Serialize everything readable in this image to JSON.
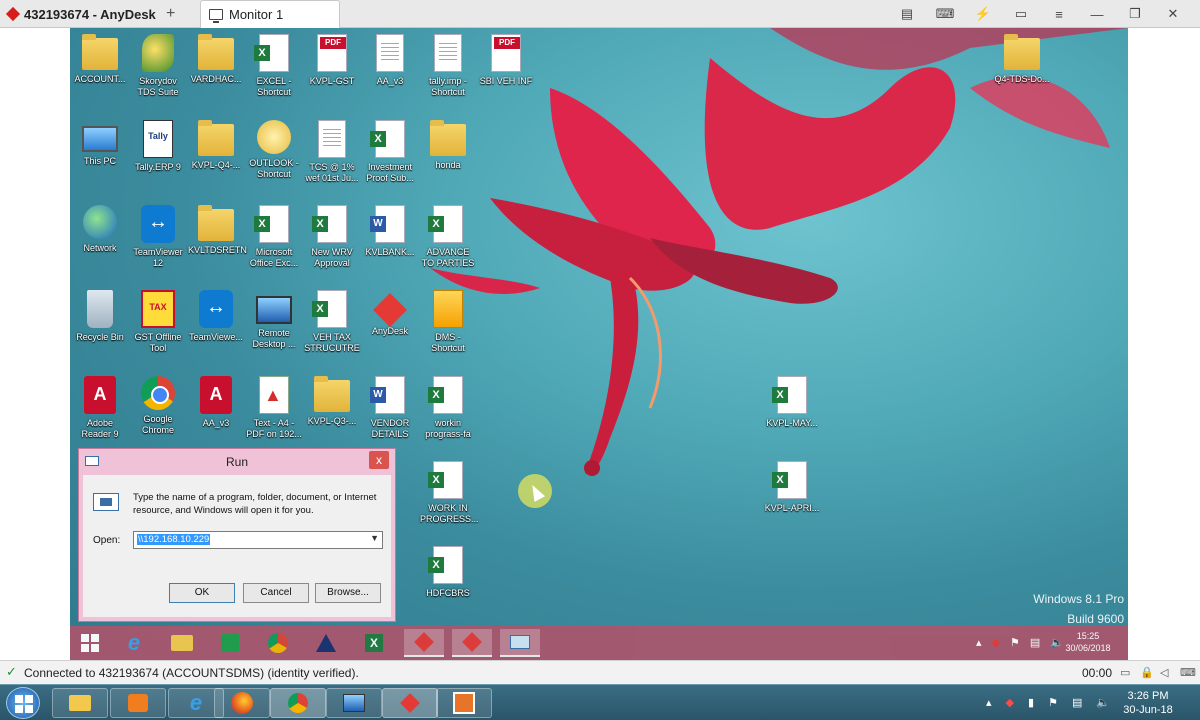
{
  "anydesk": {
    "tab1": "432193674 - AnyDesk",
    "plus": "+",
    "tab2": "Monitor 1",
    "tools": [
      "chat-icon",
      "keyboard-icon",
      "lightning-icon",
      "display-icon",
      "menu-icon",
      "minimize-icon",
      "restore-icon",
      "close-icon"
    ],
    "tool_glyphs": [
      "▤",
      "⌨",
      "⚡",
      "▭",
      "≡",
      "—",
      "❐",
      "✕"
    ]
  },
  "desktop": {
    "icons": [
      {
        "label": "ACCOUNT...",
        "kind": "folder"
      },
      {
        "label": "Skorydov\nTDS Suite",
        "kind": "skory"
      },
      {
        "label": "VARDHAC...",
        "kind": "folder"
      },
      {
        "label": "EXCEL -\nShortcut",
        "kind": "excel"
      },
      {
        "label": "KVPL-GST",
        "kind": "pdf"
      },
      {
        "label": "AA_v3",
        "kind": "doc"
      },
      {
        "label": "tally.imp -\nShortcut",
        "kind": "doc"
      },
      {
        "label": "SBI VEH INF",
        "kind": "pdf"
      },
      {
        "label": "This PC",
        "kind": "pc"
      },
      {
        "label": "Tally.ERP 9",
        "kind": "tally"
      },
      {
        "label": "KVPL-Q4-...",
        "kind": "folder"
      },
      {
        "label": "OUTLOOK -\nShortcut",
        "kind": "outlook"
      },
      {
        "label": "TCS @ 1%\nwef 01st Ju...",
        "kind": "doc"
      },
      {
        "label": "Investment\nProof Sub...",
        "kind": "excel"
      },
      {
        "label": "honda",
        "kind": "folder"
      },
      {
        "label": "Network",
        "kind": "globe"
      },
      {
        "label": "TeamViewer\n12",
        "kind": "tv"
      },
      {
        "label": "KVLTDSRETN",
        "kind": "folder"
      },
      {
        "label": "Microsoft\nOffice Exc...",
        "kind": "excel"
      },
      {
        "label": "New WRV\nApproval",
        "kind": "excel"
      },
      {
        "label": "KVLBANK...",
        "kind": "word"
      },
      {
        "label": "ADVANCE\nTO PARTIES",
        "kind": "excel"
      },
      {
        "label": "Recycle Bin",
        "kind": "bin"
      },
      {
        "label": "GST Offline\nTool",
        "kind": "gst"
      },
      {
        "label": "TeamViewe...",
        "kind": "tv"
      },
      {
        "label": "Remote\nDesktop ...",
        "kind": "rdp"
      },
      {
        "label": "VEH TAX\nSTRUCUTRE",
        "kind": "excel"
      },
      {
        "label": "AnyDesk",
        "kind": "any"
      },
      {
        "label": "DMS -\nShortcut",
        "kind": "dms"
      },
      {
        "label": "Adobe\nReader 9",
        "kind": "adobe"
      },
      {
        "label": "Google\nChrome",
        "kind": "chrome"
      },
      {
        "label": "AA_v3",
        "kind": "adobe"
      },
      {
        "label": "Text - A4 -\nPDF on 192...",
        "kind": "txt"
      },
      {
        "label": "KVPL-Q3-...",
        "kind": "folder"
      },
      {
        "label": "VENDOR\nDETAILS",
        "kind": "word"
      },
      {
        "label": "workin\nprograss-fa",
        "kind": "excel"
      },
      {
        "label": "WORK IN\nPROGRESS...",
        "kind": "excel"
      },
      {
        "label": "HDFCBRS",
        "kind": "excel"
      },
      {
        "label": "Q4-TDS-Do...",
        "kind": "folder"
      },
      {
        "label": "KVPL-MAY...",
        "kind": "excel"
      },
      {
        "label": "KVPL-APRI...",
        "kind": "excel"
      }
    ],
    "watermark_line1": "Windows 8.1 Pro",
    "watermark_line2": "Build 9600"
  },
  "run_dialog": {
    "title": "Run",
    "close": "x",
    "description": "Type the name of a program, folder, document, or Internet resource, and Windows will open it for you.",
    "open_label": "Open:",
    "open_value": "\\\\192.168.10.229",
    "ok": "OK",
    "cancel": "Cancel",
    "browse": "Browse..."
  },
  "remote_taskbar": {
    "tray": "▴",
    "time": "15:25",
    "date": "30/06/2018"
  },
  "status": {
    "message": "Connected to 432193674 (ACCOUNTSDMS) (identity verified).",
    "time": "00:00"
  },
  "host_taskbar": {
    "time": "3:26 PM",
    "date": "30-Jun-18"
  },
  "colors": {
    "remote_taskbar": "#a8576e",
    "run_frame": "#f0c2d8",
    "anydesk_red": "#d81b1b"
  }
}
